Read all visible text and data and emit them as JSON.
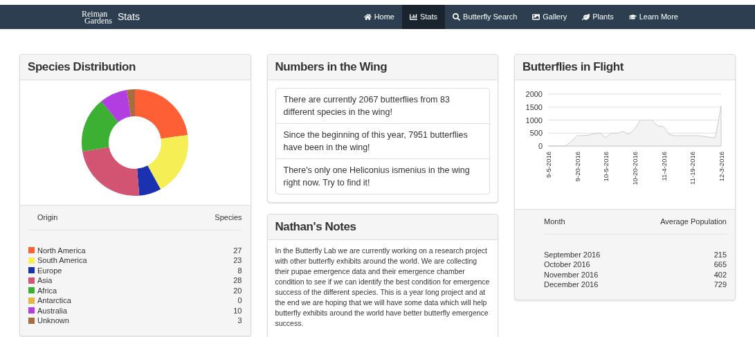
{
  "navbar": {
    "logo": [
      "Reiman",
      "Gardens"
    ],
    "brand": "Stats",
    "items": [
      {
        "label": "Home",
        "selected": false
      },
      {
        "label": "Stats",
        "selected": true
      },
      {
        "label": "Butterfly Search",
        "selected": false
      },
      {
        "label": "Gallery",
        "selected": false
      },
      {
        "label": "Plants",
        "selected": false
      },
      {
        "label": "Learn More",
        "selected": false
      }
    ]
  },
  "species_distribution": {
    "title": "Species Distribution",
    "chart_data": {
      "type": "donut",
      "values": [
        22.7,
        19.3,
        6.7,
        23.6,
        16.8,
        0,
        8.4,
        2.5
      ]
    },
    "columns": [
      "Origin",
      "Species"
    ],
    "rows": [
      {
        "origin": "North America",
        "species": "27",
        "color": "#fe5f34"
      },
      {
        "origin": "South America",
        "species": "23",
        "color": "#f5ef55"
      },
      {
        "origin": "Europe",
        "species": "8",
        "color": "#1a31b0"
      },
      {
        "origin": "Asia",
        "species": "28",
        "color": "#d35472"
      },
      {
        "origin": "Africa",
        "species": "20",
        "color": "#3bb033"
      },
      {
        "origin": "Antarctica",
        "species": "0",
        "color": "#e5b53f"
      },
      {
        "origin": "Australia",
        "species": "10",
        "color": "#b23de1"
      },
      {
        "origin": "Unknown",
        "species": "3",
        "color": "#a86d3f"
      }
    ]
  },
  "numbers_in_the_wing": {
    "title": "Numbers in the Wing",
    "items": [
      "There are currently 2067 butterflies from 83 different species in the wing!",
      "Since the beginning of this year, 7951 butterflies have been in the wing!",
      "There's only one Heliconius ismenius in the wing right now. Try to find it!"
    ]
  },
  "nathans_notes": {
    "title": "Nathan's Notes",
    "text": "In the Butterfly Lab we are currently working on a research project with other butterfly exhibits around the world. We are collecting their pupae emergence data and their emergence chamber condition to see if we can identify the best condition for emergence success of the different species. This is a year long project and at the end we are hoping that we will have some data which will help butterfly exhibits around the world have better butterfly emergence success."
  },
  "butterflies_in_flight": {
    "title": "Butterflies in Flight",
    "chart_data": {
      "type": "area",
      "categories": [
        "9-5-2016",
        null,
        null,
        null,
        null,
        "9-20-2016",
        null,
        null,
        null,
        null,
        "10-5-2016",
        null,
        null,
        null,
        null,
        "10-20-2016",
        null,
        null,
        null,
        null,
        "11-4-2016",
        null,
        null,
        null,
        null,
        "11-19-2016",
        null,
        null,
        null,
        null,
        "12-3-2016"
      ],
      "values": [
        0,
        0,
        0,
        0,
        170,
        400,
        400,
        420,
        470,
        500,
        320,
        500,
        490,
        560,
        450,
        650,
        1000,
        1000,
        1000,
        780,
        750,
        450,
        400,
        400,
        400,
        400,
        400,
        370,
        340,
        320,
        1550
      ],
      "ylim": [
        0,
        2000
      ],
      "yticks": [
        0,
        500,
        1000,
        1500,
        2000
      ],
      "grid": true
    },
    "columns": [
      "Month",
      "Average Population"
    ],
    "rows": [
      {
        "month": "September 2016",
        "population": "215"
      },
      {
        "month": "October 2016",
        "population": "665"
      },
      {
        "month": "November 2016",
        "population": "402"
      },
      {
        "month": "December 2016",
        "population": "729"
      }
    ]
  }
}
